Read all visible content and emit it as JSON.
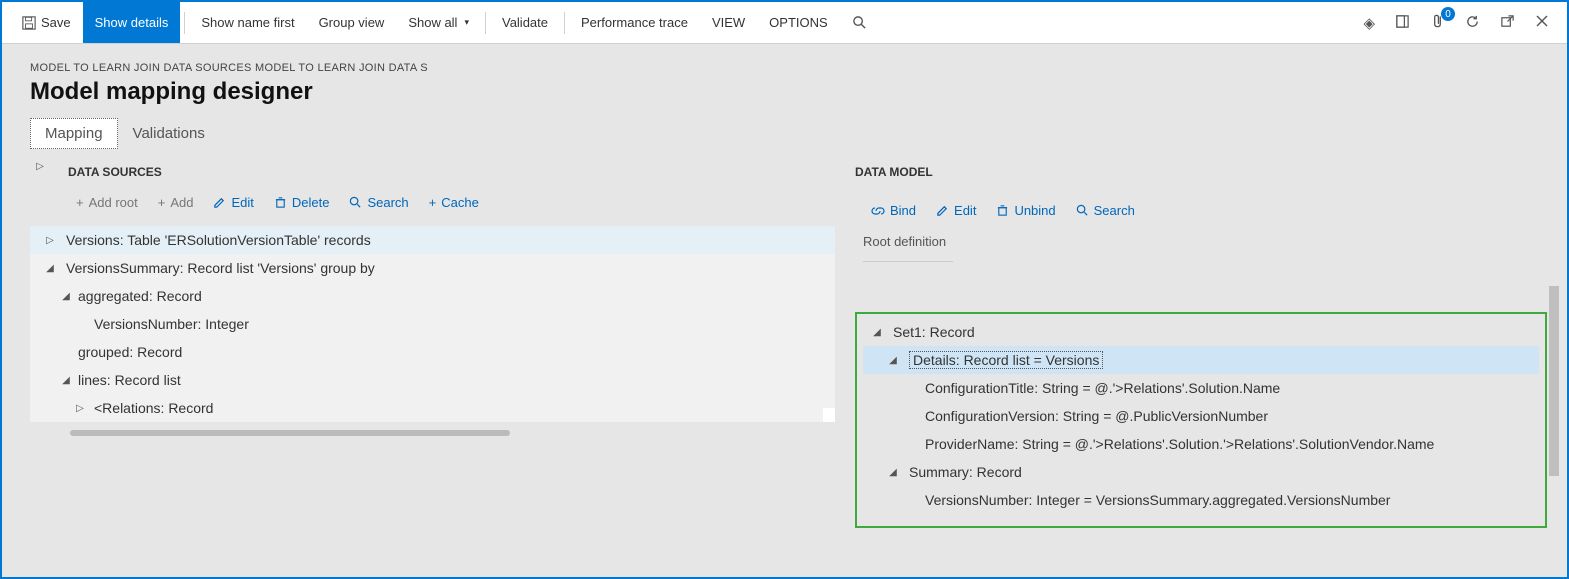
{
  "toolbar": {
    "save": "Save",
    "show_details": "Show details",
    "show_name_first": "Show name first",
    "group_view": "Group view",
    "show_all": "Show all",
    "validate": "Validate",
    "performance_trace": "Performance trace",
    "view": "VIEW",
    "options": "OPTIONS",
    "badge_count": "0"
  },
  "breadcrumb": "MODEL TO LEARN JOIN DATA SOURCES MODEL TO LEARN JOIN DATA S",
  "page_title": "Model mapping designer",
  "tabs": {
    "mapping": "Mapping",
    "validations": "Validations"
  },
  "ds": {
    "heading": "DATA SOURCES",
    "add_root": "Add root",
    "add": "Add",
    "edit": "Edit",
    "delete": "Delete",
    "search": "Search",
    "cache": "Cache",
    "nodes": {
      "versions": "Versions: Table 'ERSolutionVersionTable' records",
      "versions_summary": "VersionsSummary: Record list 'Versions' group by",
      "aggregated": "aggregated: Record",
      "versions_number": "VersionsNumber: Integer",
      "grouped": "grouped: Record",
      "lines": "lines: Record list",
      "relations": "<Relations: Record"
    }
  },
  "dm": {
    "heading": "DATA MODEL",
    "bind": "Bind",
    "edit": "Edit",
    "unbind": "Unbind",
    "search": "Search",
    "root_def": "Root definition",
    "nodes": {
      "set1": "Set1: Record",
      "details": "Details: Record list = Versions",
      "config_title": "ConfigurationTitle: String = @.'>Relations'.Solution.Name",
      "config_version": "ConfigurationVersion: String = @.PublicVersionNumber",
      "provider_name": "ProviderName: String = @.'>Relations'.Solution.'>Relations'.SolutionVendor.Name",
      "summary": "Summary: Record",
      "versions_number": "VersionsNumber: Integer = VersionsSummary.aggregated.VersionsNumber"
    }
  }
}
